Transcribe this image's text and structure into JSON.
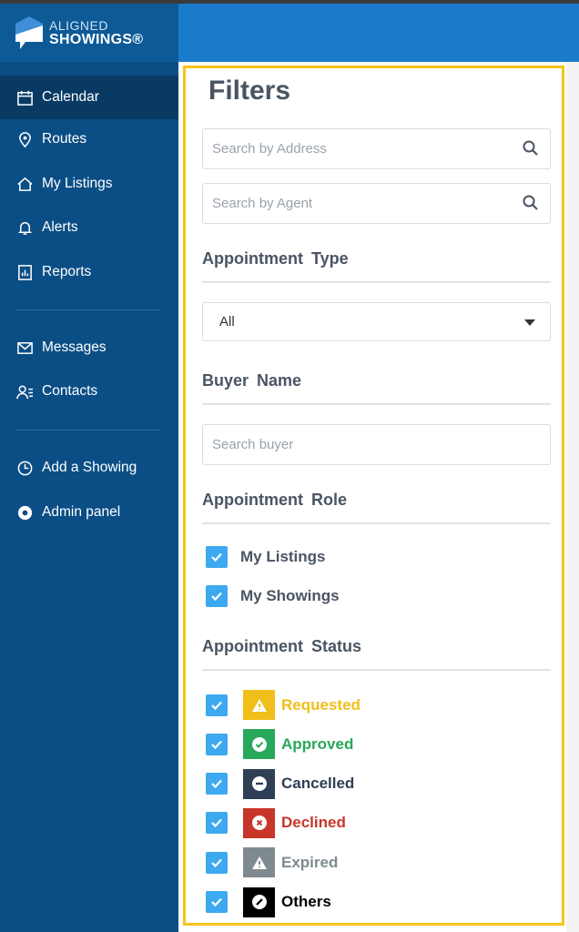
{
  "brand": {
    "line1": "ALIGNED",
    "line2": "SHOWINGS®"
  },
  "sidebar": {
    "items": [
      {
        "label": "Calendar",
        "icon": "calendar-icon"
      },
      {
        "label": "Routes",
        "icon": "map-pin-icon"
      },
      {
        "label": "My Listings",
        "icon": "home-icon"
      },
      {
        "label": "Alerts",
        "icon": "bell-icon"
      },
      {
        "label": "Reports",
        "icon": "report-icon"
      },
      {
        "label": "Messages",
        "icon": "mail-icon"
      },
      {
        "label": "Contacts",
        "icon": "contacts-icon"
      },
      {
        "label": "Add a Showing",
        "icon": "clock-icon"
      },
      {
        "label": "Admin panel",
        "icon": "admin-icon"
      }
    ]
  },
  "filters": {
    "title": "Filters",
    "address_placeholder": "Search by Address",
    "agent_placeholder": "Search by Agent",
    "appointment_type_label": "Appointment Type",
    "appointment_type_value": "All",
    "buyer_label": "Buyer Name",
    "buyer_placeholder": "Search buyer",
    "role_label": "Appointment Role",
    "roles": [
      {
        "label": "My Listings",
        "checked": true
      },
      {
        "label": "My Showings",
        "checked": true
      }
    ],
    "status_label": "Appointment Status",
    "statuses": [
      {
        "label": "Requested",
        "color": "#f0bf1a",
        "checked": true
      },
      {
        "label": "Approved",
        "color": "#27a85a",
        "checked": true
      },
      {
        "label": "Cancelled",
        "color": "#2e3f56",
        "checked": true
      },
      {
        "label": "Declined",
        "color": "#c8352b",
        "checked": true
      },
      {
        "label": "Expired",
        "color": "#7f8a90",
        "checked": true
      },
      {
        "label": "Others",
        "color": "#000000",
        "checked": true
      }
    ]
  }
}
